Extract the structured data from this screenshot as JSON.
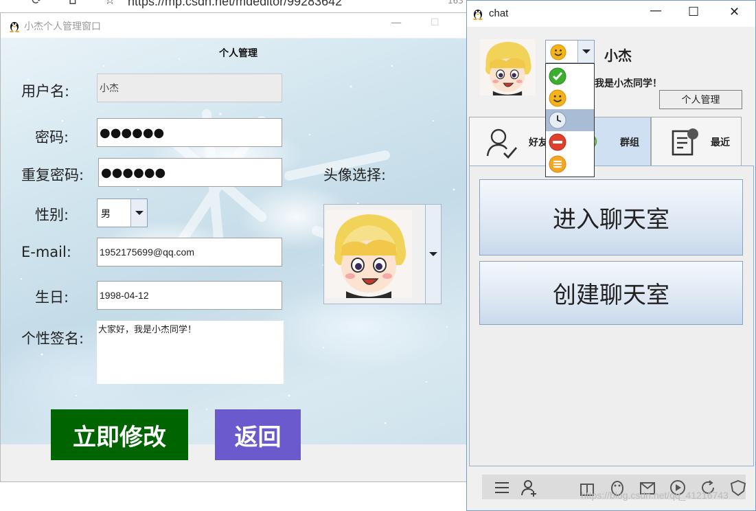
{
  "browser": {
    "url_fragment": "https://mp.csdn.net/mdeditor/99283642",
    "right_fragment": "163"
  },
  "profile_window": {
    "title": "小杰个人管理窗口",
    "heading": "个人管理",
    "labels": {
      "username": "用户名:",
      "password": "密码:",
      "repeat_password": "重复密码:",
      "gender": "性别:",
      "email": "E-mail:",
      "birthday": "生日:",
      "signature": "个性签名:",
      "avatar": "头像选择:"
    },
    "values": {
      "username": "小杰",
      "password": "●●●●●●",
      "repeat_password": "●●●●●●",
      "gender": "男",
      "email": "1952175699@qq.com",
      "birthday": "1998-04-12",
      "signature": "大家好，我是小杰同学！"
    },
    "buttons": {
      "modify": "立即修改",
      "back": "返回"
    }
  },
  "chat_window": {
    "title": "chat",
    "controls": {
      "minimize": "—",
      "maximize": "☐",
      "close": "✕"
    },
    "user_name": "小杰",
    "signature_partial": "我是小杰同学！",
    "personal_button": "个人管理",
    "status_options": [
      "online",
      "happy",
      "away",
      "busy",
      "invisible"
    ],
    "selected_status": "away",
    "tabs": [
      {
        "label": "好友"
      },
      {
        "label": "群组"
      },
      {
        "label": "最近"
      }
    ],
    "selected_tab": 1,
    "actions": {
      "enter_room": "进入聊天室",
      "create_room": "创建聊天室"
    },
    "watermark": "https://blog.csdn.net/qq_41216743"
  },
  "colors": {
    "modify_button": "#006400",
    "back_button": "#6a5acd",
    "status_online": "#3cae2f",
    "status_happy": "#f5b31a",
    "status_busy": "#e0402a",
    "status_invisible": "#f5a623",
    "tab_selected": "#cfe0f3"
  }
}
